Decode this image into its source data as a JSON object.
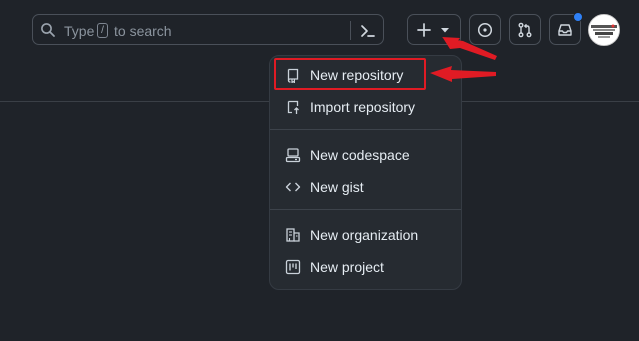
{
  "search": {
    "prefix": "Type",
    "key": "/",
    "suffix": "to search",
    "icon": "search-icon",
    "command_icon": "command-palette-icon"
  },
  "header": {
    "create_icon": "plus-icon",
    "create_caret_icon": "triangle-down-icon",
    "issues_icon": "issue-opened-icon",
    "pulls_icon": "git-pull-request-icon",
    "inbox_icon": "inbox-icon",
    "notification_color": "#2f81f7"
  },
  "create_menu": {
    "items": [
      {
        "label": "New repository",
        "icon": "repo-icon"
      },
      {
        "label": "Import repository",
        "icon": "repo-push-icon"
      },
      {
        "label": "New codespace",
        "icon": "codespaces-icon"
      },
      {
        "label": "New gist",
        "icon": "code-icon"
      },
      {
        "label": "New organization",
        "icon": "organization-icon"
      },
      {
        "label": "New project",
        "icon": "project-icon"
      }
    ]
  },
  "annotation": {
    "highlight_color": "#e01b24"
  }
}
